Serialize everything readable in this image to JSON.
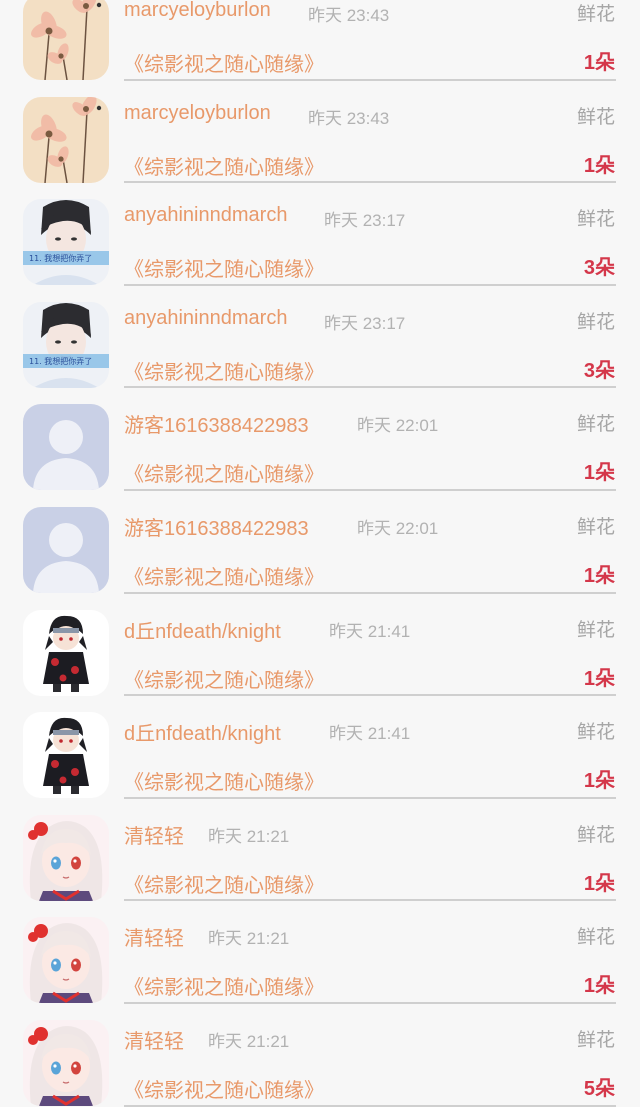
{
  "feed": [
    {
      "user": "marcyeloyburlon",
      "time": "昨天 23:43",
      "gift": "鲜花",
      "work": "《综影视之随心随缘》",
      "count": "1朵",
      "avatar": "flower-avatar"
    },
    {
      "user": "marcyeloyburlon",
      "time": "昨天 23:43",
      "gift": "鲜花",
      "work": "《综影视之随心随缘》",
      "count": "1朵",
      "avatar": "flower-avatar"
    },
    {
      "user": "anyahininndmarch",
      "time": "昨天 23:17",
      "gift": "鲜花",
      "work": "《综影视之随心随缘》",
      "count": "3朵",
      "avatar": "portrait-avatar"
    },
    {
      "user": "anyahininndmarch",
      "time": "昨天 23:17",
      "gift": "鲜花",
      "work": "《综影视之随心随缘》",
      "count": "3朵",
      "avatar": "portrait-avatar"
    },
    {
      "user": "游客1616388422983",
      "time": "昨天 22:01",
      "gift": "鲜花",
      "work": "《综影视之随心随缘》",
      "count": "1朵",
      "avatar": "default-avatar"
    },
    {
      "user": "游客1616388422983",
      "time": "昨天 22:01",
      "gift": "鲜花",
      "work": "《综影视之随心随缘》",
      "count": "1朵",
      "avatar": "default-avatar"
    },
    {
      "user": "d丘nfdeath/knight",
      "time": "昨天 21:41",
      "gift": "鲜花",
      "work": "《综影视之随心随缘》",
      "count": "1朵",
      "avatar": "ninja-avatar"
    },
    {
      "user": "d丘nfdeath/knight",
      "time": "昨天 21:41",
      "gift": "鲜花",
      "work": "《综影视之随心随缘》",
      "count": "1朵",
      "avatar": "ninja-avatar"
    },
    {
      "user": "清轻轻",
      "time": "昨天 21:21",
      "gift": "鲜花",
      "work": "《综影视之随心随缘》",
      "count": "1朵",
      "avatar": "anime-girl-avatar"
    },
    {
      "user": "清轻轻",
      "time": "昨天 21:21",
      "gift": "鲜花",
      "work": "《综影视之随心随缘》",
      "count": "1朵",
      "avatar": "anime-girl-avatar"
    },
    {
      "user": "清轻轻",
      "time": "昨天 21:21",
      "gift": "鲜花",
      "work": "《综影视之随心随缘》",
      "count": "5朵",
      "avatar": "anime-girl-avatar"
    }
  ],
  "avatar_texts": {
    "portrait_caption": "11. 我想把你弄了"
  },
  "colors": {
    "name": "#e8996a",
    "count": "#d4374a",
    "meta": "#b2b2b2",
    "divider": "#cfcfcf",
    "background": "#f7f7f7"
  }
}
